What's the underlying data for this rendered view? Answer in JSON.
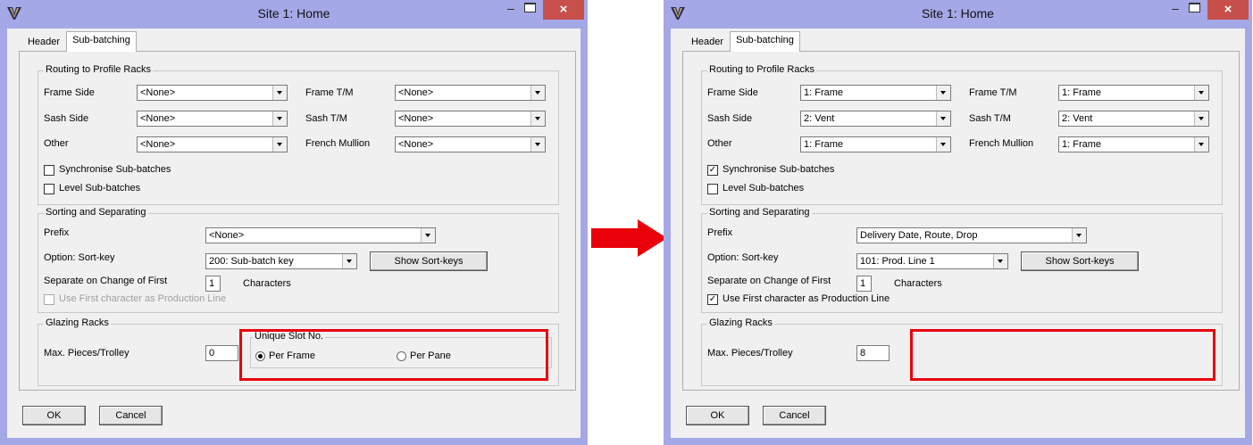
{
  "colors": {
    "window_border": "#a5a8e6",
    "close_button": "#c7504a",
    "highlight": "#e8000a",
    "arrow": "#e8000a"
  },
  "icons": [
    "app-icon",
    "minimize-icon",
    "maximize-icon",
    "close-icon",
    "arrow-right-icon"
  ],
  "dialogs": [
    {
      "title": "Site 1: Home",
      "close_glyph": "×",
      "tabs": {
        "header": "Header",
        "sub_batching": "Sub-batching"
      },
      "routing": {
        "group": "Routing to Profile Racks",
        "frame_side": {
          "label": "Frame Side",
          "value": "<None>"
        },
        "sash_side": {
          "label": "Sash Side",
          "value": "<None>"
        },
        "other": {
          "label": "Other",
          "value": "<None>"
        },
        "frame_tm": {
          "label": "Frame T/M",
          "value": "<None>"
        },
        "sash_tm": {
          "label": "Sash T/M",
          "value": "<None>"
        },
        "french_mullion": {
          "label": "French Mullion",
          "value": "<None>"
        },
        "sync": {
          "label": "Synchronise Sub-batches",
          "checked": false
        },
        "level": {
          "label": "Level Sub-batches",
          "checked": false
        }
      },
      "sorting": {
        "group": "Sorting and Separating",
        "prefix": {
          "label": "Prefix",
          "value": "<None>"
        },
        "sortkey": {
          "label": "Option: Sort-key",
          "value": "200: Sub-batch key"
        },
        "show_sortkeys": "Show Sort-keys",
        "separate": {
          "label": "Separate on Change of First",
          "value": "1",
          "suffix": "Characters"
        },
        "use_first": {
          "label": "Use First character as Production Line",
          "checked": false,
          "disabled": true
        }
      },
      "glazing": {
        "group": "Glazing Racks",
        "max_pieces": {
          "label": "Max. Pieces/Trolley",
          "value": "0"
        },
        "unique_slot": {
          "group": "Unique Slot No.",
          "per_frame": "Per Frame",
          "per_pane": "Per Pane",
          "selected": "per_frame"
        }
      },
      "ok": "OK",
      "cancel": "Cancel"
    },
    {
      "title": "Site 1: Home",
      "close_glyph": "×",
      "tabs": {
        "header": "Header",
        "sub_batching": "Sub-batching"
      },
      "routing": {
        "group": "Routing to Profile Racks",
        "frame_side": {
          "label": "Frame Side",
          "value": "1: Frame"
        },
        "sash_side": {
          "label": "Sash Side",
          "value": "2: Vent"
        },
        "other": {
          "label": "Other",
          "value": "1: Frame"
        },
        "frame_tm": {
          "label": "Frame T/M",
          "value": "1: Frame"
        },
        "sash_tm": {
          "label": "Sash T/M",
          "value": "2: Vent"
        },
        "french_mullion": {
          "label": "French Mullion",
          "value": "1: Frame"
        },
        "sync": {
          "label": "Synchronise Sub-batches",
          "checked": true
        },
        "level": {
          "label": "Level Sub-batches",
          "checked": false
        }
      },
      "sorting": {
        "group": "Sorting and Separating",
        "prefix": {
          "label": "Prefix",
          "value": "Delivery Date, Route, Drop"
        },
        "sortkey": {
          "label": "Option: Sort-key",
          "value": "101: Prod. Line 1"
        },
        "show_sortkeys": "Show Sort-keys",
        "separate": {
          "label": "Separate on Change of First",
          "value": "1",
          "suffix": "Characters"
        },
        "use_first": {
          "label": "Use First character as Production Line",
          "checked": true,
          "disabled": false
        }
      },
      "glazing": {
        "group": "Glazing Racks",
        "max_pieces": {
          "label": "Max. Pieces/Trolley",
          "value": "8"
        }
      },
      "ok": "OK",
      "cancel": "Cancel"
    }
  ]
}
